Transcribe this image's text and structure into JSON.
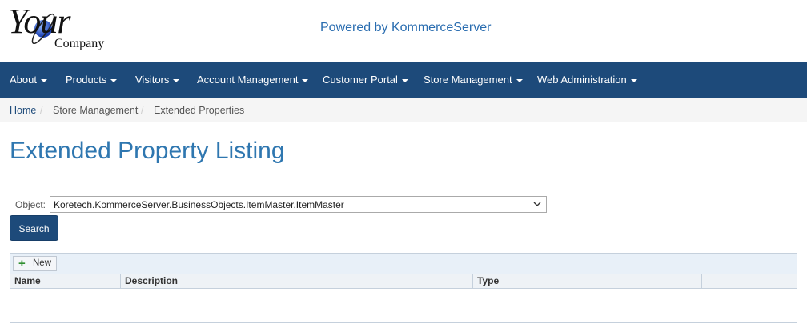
{
  "header": {
    "logo_main": "Your",
    "logo_sub": "Company",
    "powered_by": "Powered by KommerceServer"
  },
  "nav": {
    "items": [
      {
        "label": "About"
      },
      {
        "label": "Products"
      },
      {
        "label": "Visitors"
      },
      {
        "label": "Account Management"
      },
      {
        "label": "Customer Portal"
      },
      {
        "label": "Store Management"
      },
      {
        "label": "Web Administration"
      }
    ]
  },
  "breadcrumb": {
    "items": [
      {
        "label": "Home"
      },
      {
        "label": "Store Management"
      },
      {
        "label": "Extended Properties"
      }
    ],
    "separator": "/"
  },
  "page": {
    "title": "Extended Property Listing"
  },
  "filter": {
    "object_label": "Object:",
    "object_value": "Koretech.KommerceServer.BusinessObjects.ItemMaster.ItemMaster",
    "search_label": "Search"
  },
  "grid": {
    "new_label": "New",
    "columns": [
      "Name",
      "Description",
      "Type",
      ""
    ],
    "rows": []
  },
  "colors": {
    "navbar": "#1d4a7a",
    "title": "#2f77b0",
    "link": "#2a6db0"
  }
}
